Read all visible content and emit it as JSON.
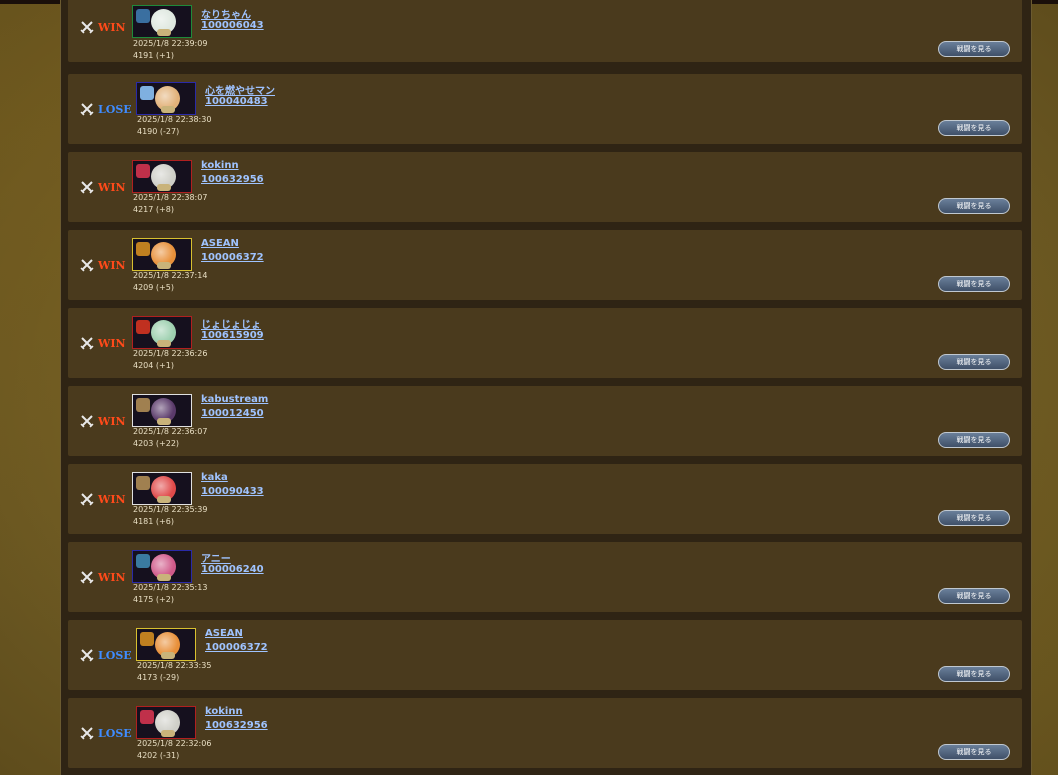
{
  "matches": [
    {
      "result": "WIN",
      "name": "なりちゃん",
      "id": "100006043",
      "time": "2025/1/8 22:39:09",
      "rating": "4191 (+1)",
      "button": "戦闘を見る"
    },
    {
      "result": "LOSE",
      "name": "心を燃やせマン",
      "id": "100040483",
      "time": "2025/1/8 22:38:30",
      "rating": "4190 (-27)",
      "button": "戦闘を見る"
    },
    {
      "result": "WIN",
      "name": "kokinn",
      "id": "100632956",
      "time": "2025/1/8 22:38:07",
      "rating": "4217 (+8)",
      "button": "戦闘を見る"
    },
    {
      "result": "WIN",
      "name": "ASEAN",
      "id": "100006372",
      "time": "2025/1/8 22:37:14",
      "rating": "4209 (+5)",
      "button": "戦闘を見る"
    },
    {
      "result": "WIN",
      "name": "じょじょじょ",
      "id": "100615909",
      "time": "2025/1/8 22:36:26",
      "rating": "4204 (+1)",
      "button": "戦闘を見る"
    },
    {
      "result": "WIN",
      "name": "kabustream",
      "id": "100012450",
      "time": "2025/1/8 22:36:07",
      "rating": "4203 (+22)",
      "button": "戦闘を見る"
    },
    {
      "result": "WIN",
      "name": "kaka",
      "id": "100090433",
      "time": "2025/1/8 22:35:39",
      "rating": "4181 (+6)",
      "button": "戦闘を見る"
    },
    {
      "result": "WIN",
      "name": "アニー",
      "id": "100006240",
      "time": "2025/1/8 22:35:13",
      "rating": "4175 (+2)",
      "button": "戦闘を見る"
    },
    {
      "result": "LOSE",
      "name": "ASEAN",
      "id": "100006372",
      "time": "2025/1/8 22:33:35",
      "rating": "4173 (-29)",
      "button": "戦闘を見る"
    },
    {
      "result": "LOSE",
      "name": "kokinn",
      "id": "100632956",
      "time": "2025/1/8 22:32:06",
      "rating": "4202 (-31)",
      "button": "戦闘を見る"
    }
  ],
  "colors": {
    "win": "#ff4a1a",
    "lose": "#3f8cff",
    "link": "#9fc3ff",
    "row_bg": "#4a3a1d"
  },
  "avatars": [
    {
      "frame": "#1f8a3a",
      "emblem": "#3a6fa0",
      "face": "#dfe8e0"
    },
    {
      "frame": "#2a2aa8",
      "emblem": "#7fb0e0",
      "face": "#e2b27a"
    },
    {
      "frame": "#b02020",
      "emblem": "#c0304a",
      "face": "#cfcfc8"
    },
    {
      "frame": "#d8c030",
      "emblem": "#c08020",
      "face": "#e8903a"
    },
    {
      "frame": "#b02020",
      "emblem": "#c03020",
      "face": "#9ed0b0"
    },
    {
      "frame": "#e0e0e0",
      "emblem": "#a08050",
      "face": "#5a3a6a"
    },
    {
      "frame": "#e0e0e0",
      "emblem": "#a08050",
      "face": "#e04a4a"
    },
    {
      "frame": "#2a2aa8",
      "emblem": "#3a7aa0",
      "face": "#d05a8a"
    },
    {
      "frame": "#d8c030",
      "emblem": "#c08020",
      "face": "#e8903a"
    },
    {
      "frame": "#b02020",
      "emblem": "#c0304a",
      "face": "#cfcfc8"
    }
  ]
}
